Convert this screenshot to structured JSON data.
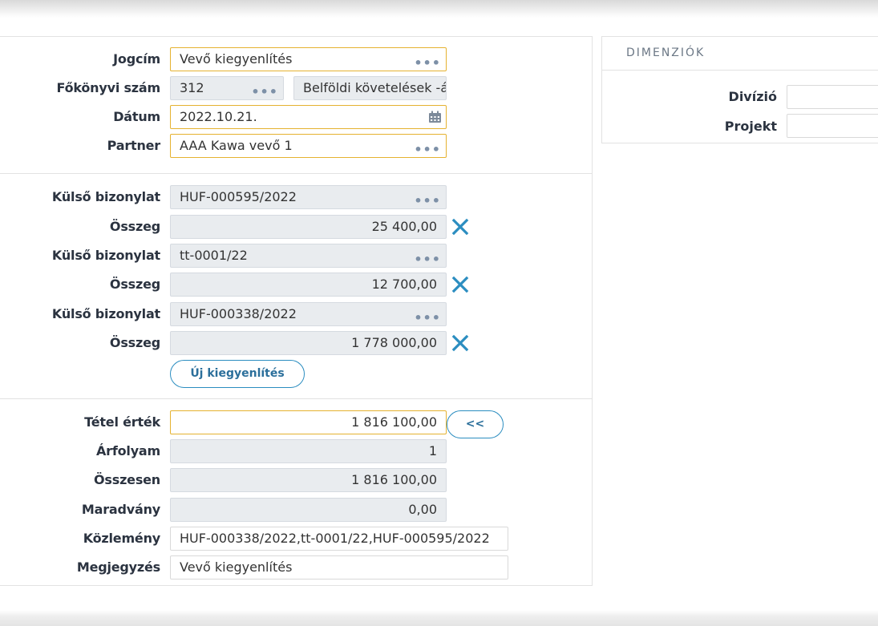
{
  "form": {
    "jogcim": {
      "label": "Jogcím",
      "value": "Vevő kiegyenlítés"
    },
    "fokonyvi": {
      "label": "Főkönyvi szám",
      "value": "312",
      "desc": "Belföldi követelések -á"
    },
    "datum": {
      "label": "Dátum",
      "value": "2022.10.21."
    },
    "partner": {
      "label": "Partner",
      "value": "AAA Kawa vevő 1"
    }
  },
  "settlements": {
    "rows": [
      {
        "doc_label": "Külső bizonylat",
        "doc_value": "HUF-000595/2022",
        "amount_label": "Összeg",
        "amount": "25 400,00"
      },
      {
        "doc_label": "Külső bizonylat",
        "doc_value": "tt-0001/22",
        "amount_label": "Összeg",
        "amount": "12 700,00"
      },
      {
        "doc_label": "Külső bizonylat",
        "doc_value": "HUF-000338/2022",
        "amount_label": "Összeg",
        "amount": "1 778 000,00"
      }
    ],
    "new_button": "Új kiegyenlítés"
  },
  "totals": {
    "tetel_ertek": {
      "label": "Tétel érték",
      "value": "1 816 100,00"
    },
    "copy_button": "<<",
    "arfolyam": {
      "label": "Árfolyam",
      "value": "1"
    },
    "osszesen": {
      "label": "Összesen",
      "value": "1 816 100,00"
    },
    "maradvany": {
      "label": "Maradvány",
      "value": "0,00"
    },
    "kozlemeny": {
      "label": "Közlemény",
      "value": "HUF-000338/2022,tt-0001/22,HUF-000595/2022"
    },
    "megjegyzes": {
      "label": "Megjegyzés",
      "value": "Vevő kiegyenlítés"
    }
  },
  "dimensions": {
    "title": "DIMENZIÓK",
    "divizio_label": "Divízió",
    "projekt_label": "Projekt"
  },
  "icons": {
    "more": "ellipsis-icon",
    "calendar": "calendar-icon",
    "remove": "close-icon"
  },
  "colors": {
    "focus_border": "#e5b230",
    "accent": "#2b8dc0",
    "readonly_bg": "#e9ecef"
  }
}
